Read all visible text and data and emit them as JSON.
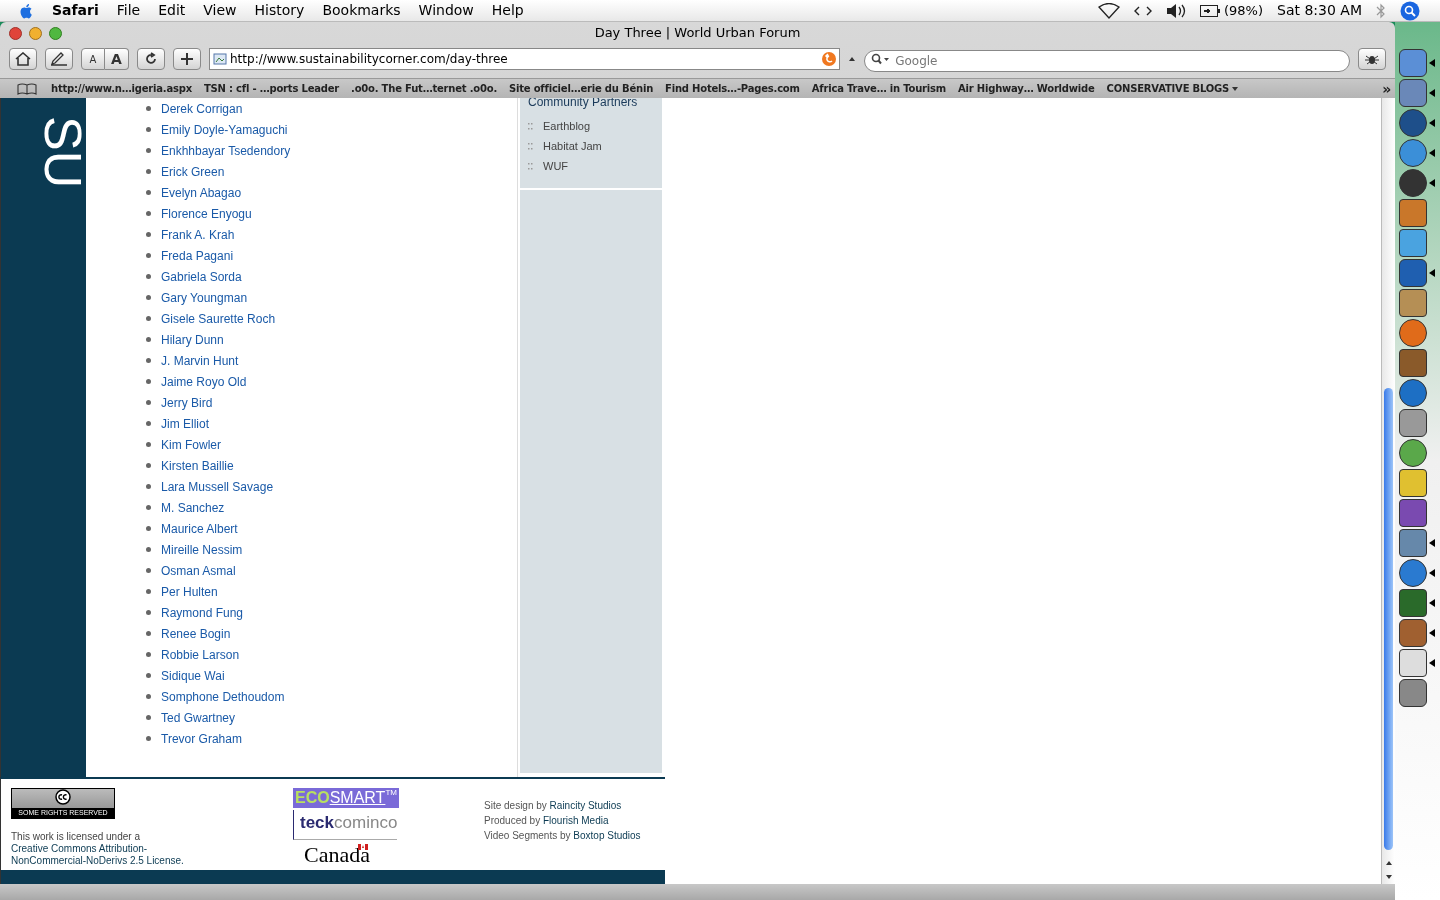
{
  "menu_bar": {
    "app": "Safari",
    "items": [
      "File",
      "Edit",
      "View",
      "History",
      "Bookmarks",
      "Window",
      "Help"
    ],
    "battery": "(98%)",
    "clock": "Sat 8:30 AM"
  },
  "window": {
    "title": "Day Three | World Urban Forum"
  },
  "toolbar": {
    "text_size_small": "A",
    "text_size_large": "A",
    "url": "http://www.sustainabilitycorner.com/day-three",
    "search_placeholder": "Google"
  },
  "bookmarks": [
    {
      "label": "http://www.n…igeria.aspx",
      "menu": false
    },
    {
      "label": "TSN : cfl - …ports Leader",
      "menu": false
    },
    {
      "label": ".o0o. The Fut…ternet .o0o.",
      "menu": false
    },
    {
      "label": "Site officiel…erie du Bénin",
      "menu": false
    },
    {
      "label": "Find Hotels…-Pages.com",
      "menu": false
    },
    {
      "label": "Africa Trave… in Tourism",
      "menu": false
    },
    {
      "label": "Air Highway… Worldwide",
      "menu": false
    },
    {
      "label": "CONSERVATIVE BLOGS",
      "menu": true
    }
  ],
  "bookmarks_more": "»",
  "page": {
    "side_logo": "SU",
    "people": [
      "Derek Corrigan",
      "Emily Doyle-Yamaguchi",
      "Enkhhbayar Tsedendory",
      "Erick Green",
      "Evelyn Abagao",
      "Florence Enyogu",
      "Frank A. Krah",
      "Freda Pagani",
      "Gabriela Sorda",
      "Gary Youngman",
      "Gisele Saurette Roch",
      "Hilary Dunn",
      "J. Marvin Hunt",
      "Jaime Royo Old",
      "Jerry Bird",
      "Jim Elliot",
      "Kim Fowler",
      "Kirsten Baillie",
      "Lara Mussell Savage",
      "M. Sanchez",
      "Maurice Albert",
      "Mireille Nessim",
      "Osman Asmal",
      "Per Hulten",
      "Raymond Fung",
      "Renee Bogin",
      "Robbie Larson",
      "Sidique Wai",
      "Somphone Dethoudom",
      "Ted Gwartney",
      "Trevor Graham"
    ],
    "partners": {
      "heading": "Community Partners",
      "items": [
        "Earthblog",
        "Habitat Jam",
        "WUF"
      ]
    }
  },
  "footer": {
    "cc_badge": "SOME RIGHTS RESERVED",
    "license_text": "This work is licensed under a",
    "license_link": "Creative Commons Attribution-NonCommercial-NoDerivs 2.5 License.",
    "sponsors": {
      "ecosmart_a": "ECO",
      "ecosmart_b": "SMART",
      "ecosmart_tm": "TM",
      "teck_a": "teck",
      "teck_b": "cominco",
      "canada": "Canada"
    },
    "credits": [
      {
        "text": "Site design by",
        "link": "Raincity Studios"
      },
      {
        "text": "Produced by",
        "link": "Flourish Media"
      },
      {
        "text": "Video Segments by",
        "link": "Boxtop Studios"
      }
    ]
  },
  "dock": [
    {
      "running": true
    },
    {
      "running": true
    },
    {
      "running": true
    },
    {
      "running": true
    },
    {
      "running": true
    },
    {
      "running": false
    },
    {
      "running": false
    },
    {
      "running": true
    },
    {
      "running": false
    },
    {
      "running": false
    },
    {
      "running": false
    },
    {
      "running": false
    },
    {
      "running": false
    },
    {
      "running": false
    },
    {
      "running": false
    },
    {
      "running": false
    },
    {
      "running": true
    },
    {
      "running": true
    },
    {
      "running": true
    },
    {
      "running": true
    },
    {
      "running": true
    },
    {
      "running": false
    }
  ]
}
